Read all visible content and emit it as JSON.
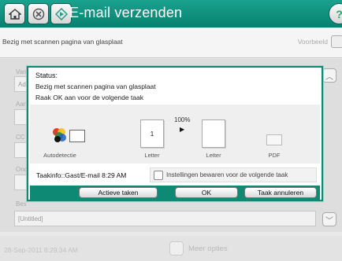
{
  "header": {
    "title": "E-mail verzenden"
  },
  "statusbar": {
    "message": "Bezig met scannen pagina van glasplaat",
    "preview_label": "Voorbeeld"
  },
  "background_form": {
    "labels": [
      "Van",
      "Aan",
      "CC",
      "Ond",
      "Bes"
    ],
    "from_value": "Adr",
    "attachment_value": "[Untitled]"
  },
  "dialog": {
    "status_label": "Status:",
    "status_line1": "Bezig met scannen pagina van glasplaat",
    "status_line2": "Raak OK aan voor de volgende taak",
    "progress_label": "100%",
    "progress": 1.0,
    "page_number": "1",
    "source_caption": "Autodetectie",
    "paper1_caption": "Letter",
    "paper2_caption": "Letter",
    "format_caption": "PDF",
    "job_info": "Taakinfo::Gast/E-mail 8:29 AM",
    "save_settings_label": "Instellingen bewaren voor de volgende taak",
    "buttons": {
      "active_jobs": "Actieve taken",
      "ok": "OK",
      "cancel_job": "Taak annuleren"
    }
  },
  "footer": {
    "datetime": "28-Sep-2011 8:29:34 AM",
    "more_options": "Meer opties"
  },
  "colors": {
    "accent": "#0d8a74",
    "topbar": "#109583"
  }
}
